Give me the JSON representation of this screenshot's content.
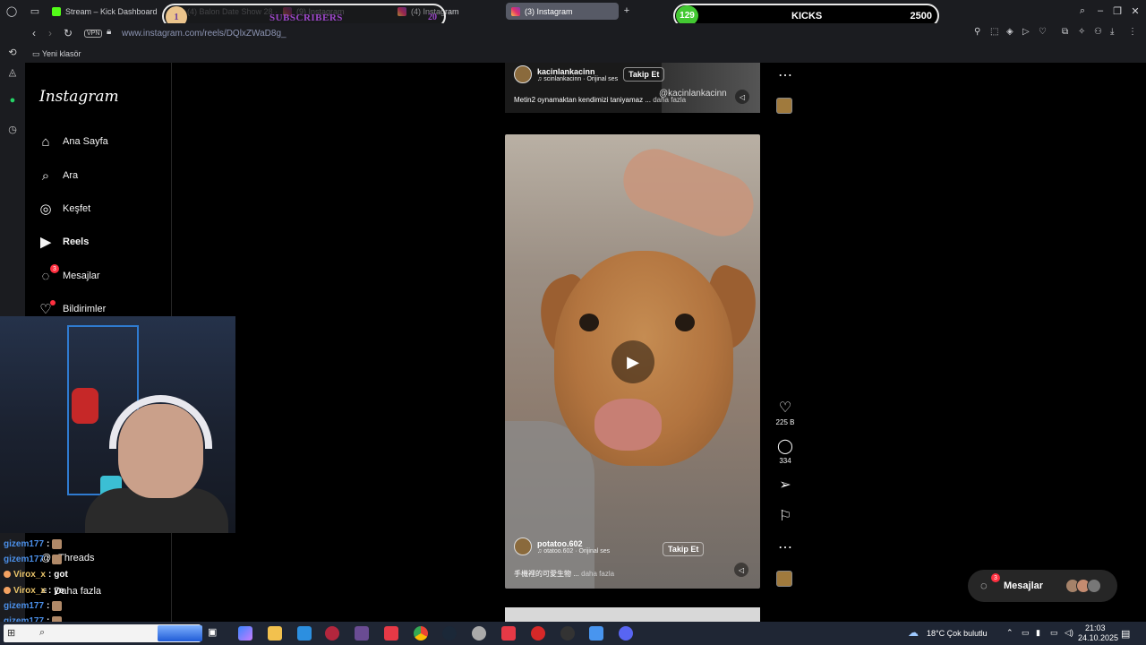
{
  "browser": {
    "tabs": [
      {
        "label": "Stream – Kick Dashboard",
        "favicon": "kick-icon"
      },
      {
        "label": "(4) Balon Date Show 28 ·",
        "favicon": "kick-icon"
      },
      {
        "label": "(9) Instagram",
        "favicon": "instagram-icon"
      },
      {
        "label": "(4) Instagram",
        "favicon": "instagram-icon"
      },
      {
        "label": "(3) Instagram",
        "favicon": "instagram-icon",
        "active": true
      }
    ],
    "new_tab": "+",
    "vpn_label": "VPN",
    "url": "www.instagram.com/reels/DQlxZWaD8g_",
    "bookmark_folder": "Yeni klasör"
  },
  "overlays": {
    "subscribers": {
      "count": "1",
      "label": "SUBSCRIBERS",
      "goal": "20"
    },
    "kicks": {
      "count": "129",
      "label": "KICKS",
      "goal": "2500"
    }
  },
  "instagram": {
    "logo": "Instagram",
    "nav": [
      {
        "label": "Ana Sayfa",
        "icon": "home-icon"
      },
      {
        "label": "Ara",
        "icon": "search-icon"
      },
      {
        "label": "Keşfet",
        "icon": "compass-icon"
      },
      {
        "label": "Reels",
        "icon": "reels-icon"
      },
      {
        "label": "Mesajlar",
        "icon": "messenger-icon",
        "badge": "3"
      },
      {
        "label": "Bildirimler",
        "icon": "heart-icon"
      }
    ],
    "threads_label": "Threads",
    "more_label": "Daha fazla",
    "reels": [
      {
        "author": "kacinlankacinn",
        "audio": "scinlankacinn · Orijinal ses",
        "follow": "Takip Et",
        "caption": "Metin2 oynamaktan kendimizi taniyamaz",
        "caption_more": "daha fazla",
        "watermark": "@kacinlankacinn"
      },
      {
        "author": "potatoo.602",
        "audio": "otatoo.602 · Orijinal ses",
        "follow": "Takip Et",
        "caption": "手機裡的可愛生物",
        "caption_more": "daha fazla"
      }
    ],
    "actions": {
      "likes": "225 B",
      "comments": "334"
    },
    "messages_pill": {
      "label": "Mesajlar",
      "badge": "3"
    }
  },
  "chat": [
    {
      "user": "gizem177",
      "msg": ""
    },
    {
      "user": "gizem177",
      "msg": ""
    },
    {
      "user": "Virox_x",
      "msg": "got"
    },
    {
      "user": "Virox_x",
      "msg": "ye"
    },
    {
      "user": "gizem177",
      "msg": ""
    },
    {
      "user": "gizem177",
      "msg": ""
    },
    {
      "user": "gizem177",
      "msg": "a"
    }
  ],
  "taskbar": {
    "weather": "18°C  Çok bulutlu",
    "time": "21:03",
    "date": "24.10.2025"
  }
}
